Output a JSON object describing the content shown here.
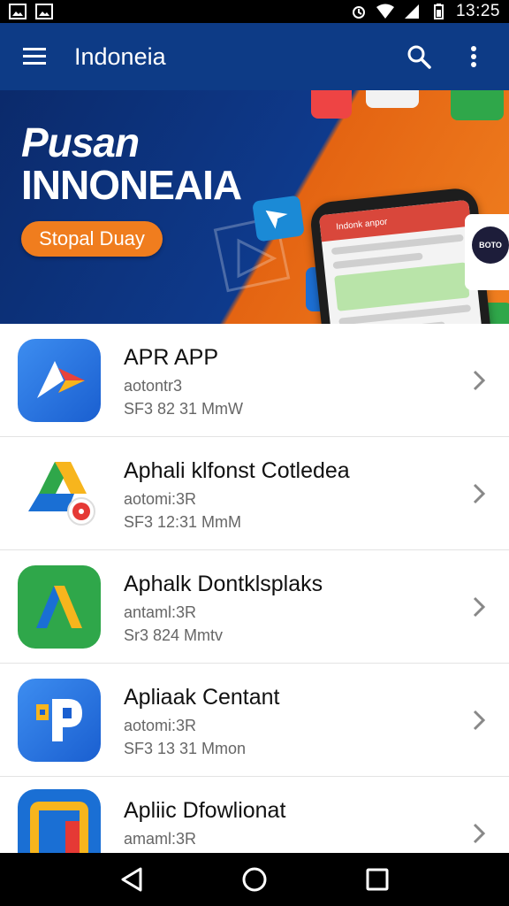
{
  "status_bar": {
    "time": "13:25",
    "left_icons": [
      "image-icon",
      "image-icon"
    ],
    "right_icons": [
      "alarm-icon",
      "wifi-icon",
      "signal-icon",
      "battery-icon"
    ]
  },
  "app_bar": {
    "title": "Indoneia",
    "icons": [
      "menu-icon",
      "search-icon",
      "more-vert-icon"
    ],
    "color": "#0d3b86"
  },
  "banner": {
    "title_line1": "Pusan",
    "title_line2": "INNONEAIA",
    "button_label": "Stopal Duay",
    "phone_header": "Indonk anpor",
    "brand_tile_text": "BOTO",
    "accent_orange": "#f07d1e"
  },
  "apps": [
    {
      "name": "APR APP",
      "line1": "aotontr3",
      "line2": "SF3 82 31 MmW",
      "icon": "arrow-logo-icon"
    },
    {
      "name": "Aphali klfonst Cotledea",
      "line1": "aotomi:3R",
      "line2": "SF3 12:31 MmM",
      "icon": "triangle-logo-icon"
    },
    {
      "name": "Aphalk Dontklsplaks",
      "line1": "antaml:3R",
      "line2": "Sr3 824 Mmtv",
      "icon": "chevron-logo-icon"
    },
    {
      "name": "Apliaak Centant",
      "line1": "aotomi:3R",
      "line2": "SF3 13 31 Mmon",
      "icon": "p-logo-icon"
    },
    {
      "name": "Apliic Dfowlionat",
      "line1": "amaml:3R",
      "line2": "",
      "icon": "square-logo-icon"
    }
  ],
  "nav_bar": {
    "icons": [
      "back-icon",
      "home-icon",
      "recents-icon"
    ]
  }
}
